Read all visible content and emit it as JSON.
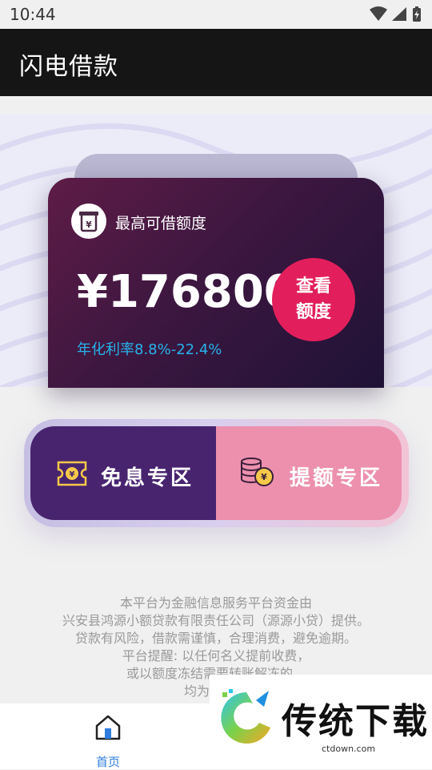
{
  "status": {
    "time": "10:44"
  },
  "app": {
    "title": "闪电借款"
  },
  "card": {
    "label": "最高可借额度",
    "amount": "¥176800",
    "view_button": "查看额度",
    "rate": "年化利率8.8%-22.4%"
  },
  "zones": {
    "left": "免息专区",
    "right": "提额专区"
  },
  "disclaimer": [
    "本平台为金融信息服务平台资金由",
    "兴安县鸿源小额贷款有限责任公司（源源小贷）提供。",
    "贷款有风险，借款需谨慎，合理消费，避免逾期。",
    "平台提醒: 以任何名义提前收费，",
    "或以额度冻结需要转账解冻的，",
    "均为诈骗，"
  ],
  "nav": {
    "home_label": "首页"
  },
  "watermark": {
    "name": "传统下载",
    "url": "ctdown.com"
  },
  "colors": {
    "app_bar": "#151515",
    "card_start": "#5e1c47",
    "card_end": "#1f1236",
    "accent_pink": "#e21f5c",
    "rate_blue": "#27b3ea",
    "zone_left": "#48246f",
    "zone_right": "#ec90ae"
  }
}
